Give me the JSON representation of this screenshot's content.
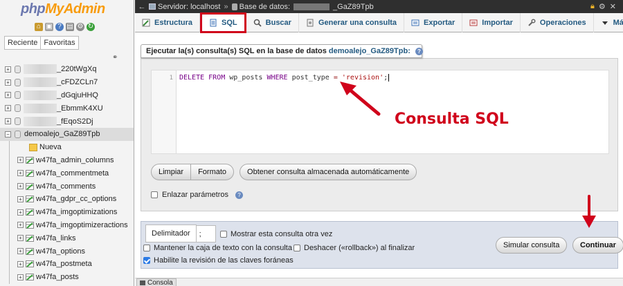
{
  "logo": {
    "php": "php",
    "myadmin": "MyAdmin"
  },
  "nav_tabs": [
    "Reciente",
    "Favoritas"
  ],
  "databases": [
    {
      "suffix": "_220tWgXq"
    },
    {
      "suffix": "_cFDZCLn7"
    },
    {
      "suffix": "_dGqjuHHQ"
    },
    {
      "suffix": "_EbmmK4XU"
    },
    {
      "suffix": "_fEqoS2Dj"
    }
  ],
  "selected_db": "demoalejo_GaZ89Tpb",
  "new_item": "Nueva",
  "tables": [
    "w47fa_admin_columns",
    "w47fa_commentmeta",
    "w47fa_comments",
    "w47fa_gdpr_cc_options",
    "w47fa_imgoptimizations",
    "w47fa_imgoptimizeractions",
    "w47fa_links",
    "w47fa_options",
    "w47fa_postmeta",
    "w47fa_posts"
  ],
  "breadcrumb": {
    "server_label": "Servidor: localhost",
    "db_label": "Base de datos:",
    "db_suffix": "_GaZ89Tpb"
  },
  "tabs": [
    {
      "label": "Estructura",
      "icon": "structure-icon"
    },
    {
      "label": "SQL",
      "icon": "sql-icon",
      "active": true
    },
    {
      "label": "Buscar",
      "icon": "search-icon"
    },
    {
      "label": "Generar una consulta",
      "icon": "query-icon"
    },
    {
      "label": "Exportar",
      "icon": "export-icon"
    },
    {
      "label": "Importar",
      "icon": "import-icon"
    },
    {
      "label": "Operaciones",
      "icon": "wrench-icon"
    },
    {
      "label": "Más",
      "icon": "chevron-down-icon"
    }
  ],
  "panel": {
    "title_prefix": "Ejecutar la(s) consulta(s) SQL en la base de datos",
    "db_name": "demoalejo_GaZ89Tpb:"
  },
  "editor": {
    "line_number": "1",
    "code_kw1": "DELETE FROM",
    "code_tbl": "wp_posts",
    "code_kw2": "WHERE",
    "code_col": "post_type",
    "code_op": "=",
    "code_str": "'revision'",
    "code_end": ";"
  },
  "buttons": {
    "clear": "Limpiar",
    "format": "Formato",
    "get_auto": "Obtener consulta almacenada automáticamente",
    "simulate": "Simular consulta",
    "continue": "Continuar"
  },
  "bind_params": "Enlazar parámetros",
  "annotation": "Consulta SQL",
  "bottom": {
    "delimiter_label": "Delimitador",
    "delimiter_value": ";",
    "show_query": "Mostrar esta consulta otra vez",
    "keep_textbox": "Mantener la caja de texto con la consulta",
    "rollback": "Deshacer («rollback») al finalizar",
    "fk_check": "Habilite la revisión de las claves foráneas"
  },
  "console_label": "Consola",
  "colors": {
    "accent": "#235a81",
    "annotation_red": "#d0021b",
    "topbar": "#2f2f2f"
  }
}
